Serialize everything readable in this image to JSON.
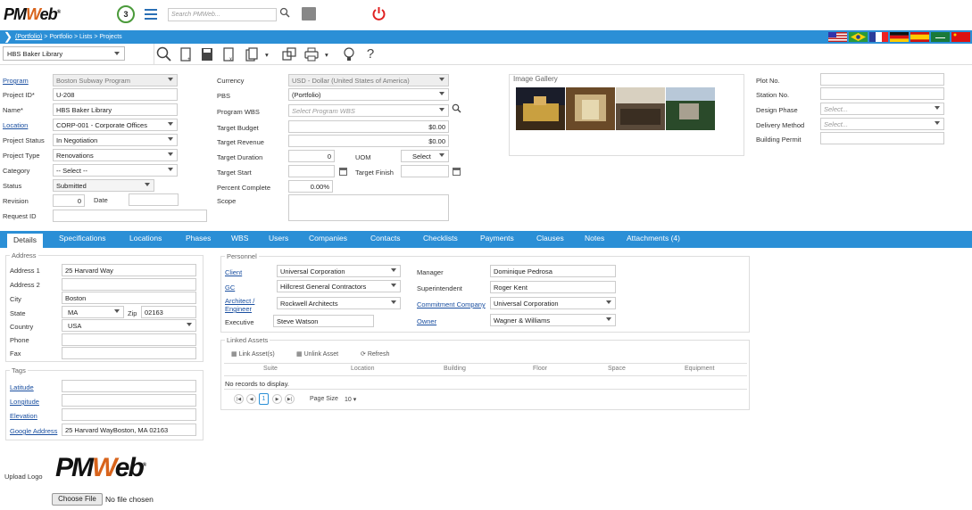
{
  "app": {
    "logo_prefix": "PM",
    "logo_w": "W",
    "logo_suffix": "eb",
    "logo_tm": "®",
    "shield_count": "3",
    "search_placeholder": "Search PMWeb..."
  },
  "breadcrumb": {
    "root": "(Portfolio)",
    "rest": " > Portfolio > Lists > Projects"
  },
  "toolbar": {
    "record": "HBS Baker Library"
  },
  "form": {
    "program_label": "Program",
    "program_value": "Boston Subway Program",
    "projectid_label": "Project ID*",
    "projectid_value": "U-208",
    "name_label": "Name*",
    "name_value": "HBS Baker Library",
    "location_label": "Location",
    "location_value": "CORP-001 - Corporate Offices",
    "status_label": "Project Status",
    "status_value": "In Negotiation",
    "type_label": "Project Type",
    "type_value": "Renovations",
    "category_label": "Category",
    "category_value": "-- Select --",
    "statusb_label": "Status",
    "statusb_value": "Submitted",
    "revision_label": "Revision",
    "revision_value": "0",
    "date_label": "Date",
    "requestid_label": "Request ID",
    "currency_label": "Currency",
    "currency_value": "USD - Dollar (United States of America)",
    "pbs_label": "PBS",
    "pbs_value": "(Portfolio)",
    "pwbs_label": "Program WBS",
    "pwbs_placeholder": "Select Program WBS",
    "budget_label": "Target Budget",
    "budget_value": "$0.00",
    "revenue_label": "Target Revenue",
    "revenue_value": "$0.00",
    "duration_label": "Target Duration",
    "duration_value": "0",
    "uom_label": "UOM",
    "uom_value": "Select",
    "start_label": "Target Start",
    "finish_label": "Target Finish",
    "percent_label": "Percent Complete",
    "percent_value": "0.00%",
    "scope_label": "Scope",
    "gallery_label": "Image Gallery",
    "plot_label": "Plot No.",
    "station_label": "Station No.",
    "design_label": "Design Phase",
    "design_placeholder": "Select...",
    "delivery_label": "Delivery Method",
    "delivery_placeholder": "Select...",
    "permit_label": "Building Permit"
  },
  "tabs": [
    "Details",
    "Specifications",
    "Locations",
    "Phases",
    "WBS",
    "Users",
    "Companies",
    "Contacts",
    "Checklists",
    "Payments",
    "Clauses",
    "Notes",
    "Attachments (4)"
  ],
  "address": {
    "title": "Address",
    "a1_label": "Address 1",
    "a1": "25 Harvard Way",
    "a2_label": "Address 2",
    "city_label": "City",
    "city": "Boston",
    "state_label": "State",
    "state": "MA",
    "zip_label": "Zip",
    "zip": "02163",
    "country_label": "Country",
    "country": "USA",
    "phone_label": "Phone",
    "fax_label": "Fax"
  },
  "tags": {
    "title": "Tags",
    "lat": "Latitude",
    "lon": "Longitude",
    "elev": "Elevation",
    "gaddr": "Google Address",
    "gaddr_value": "25 Harvard WayBoston, MA 02163"
  },
  "personnel": {
    "title": "Personnel",
    "client_label": "Client",
    "client": "Universal Corporation",
    "gc_label": "GC",
    "gc": "Hillcrest General Contractors",
    "arch_label": "Architect / Engineer",
    "arch": "Rockwell Architects",
    "exec_label": "Executive",
    "exec": "Steve Watson",
    "mgr_label": "Manager",
    "mgr": "Dominique Pedrosa",
    "sup_label": "Superintendent",
    "sup": "Roger Kent",
    "commit_label": "Commitment Company",
    "commit": "Universal Corporation",
    "owner_label": "Owner",
    "owner": "Wagner & Williams"
  },
  "assets": {
    "title": "Linked Assets",
    "link": "Link Asset(s)",
    "unlink": "Unlink Asset",
    "refresh": "Refresh",
    "cols": [
      "Suite",
      "Location",
      "Building",
      "Floor",
      "Space",
      "Equipment"
    ],
    "empty": "No records to display.",
    "page": "1",
    "pagesize_label": "Page Size",
    "pagesize": "10"
  },
  "upload": {
    "label": "Upload Logo",
    "button": "Choose File",
    "status": "No file chosen"
  }
}
